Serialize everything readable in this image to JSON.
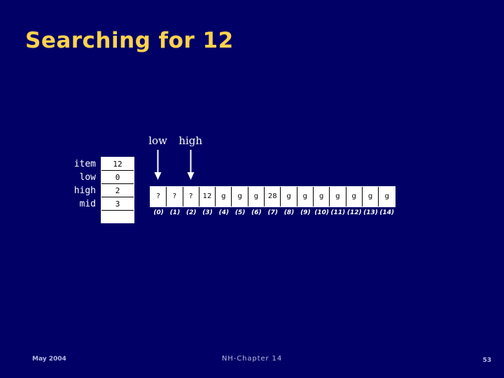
{
  "slide": {
    "title": "Searching for 12",
    "background_color": "#000066",
    "title_color": "#ffd24d"
  },
  "variables": {
    "rows": [
      {
        "label": "item",
        "value": "12"
      },
      {
        "label": "low",
        "value": "0"
      },
      {
        "label": "high",
        "value": "2"
      },
      {
        "label": "mid",
        "value": "3"
      },
      {
        "label": "",
        "value": ""
      }
    ]
  },
  "pointers": [
    {
      "name": "low",
      "label": "low",
      "index": 0
    },
    {
      "name": "high",
      "label": "high",
      "index": 2
    }
  ],
  "array": {
    "cells": [
      "?",
      "?",
      "?",
      "12",
      "g",
      "g",
      "g",
      "28",
      "g",
      "g",
      "g",
      "g",
      "g",
      "g",
      "g"
    ],
    "indices": [
      "(0)",
      "(1)",
      "(2)",
      "(3)",
      "(4)",
      "(5)",
      "(6)",
      "(7)",
      "(8)",
      "(9)",
      "(10)",
      "(11)",
      "(12)",
      "(13)",
      "(14)"
    ]
  },
  "footer": {
    "date": "May 2004",
    "center": "NH-Chapter 14",
    "page": "53"
  }
}
